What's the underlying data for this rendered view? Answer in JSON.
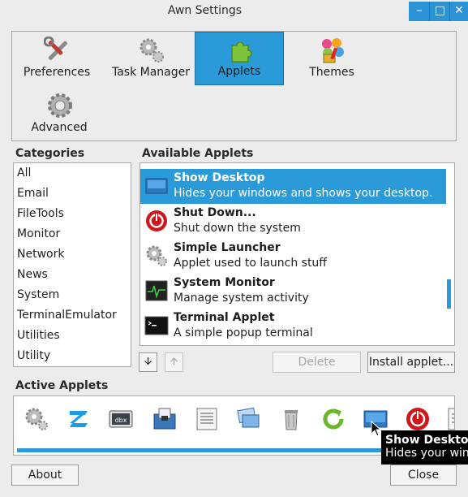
{
  "window": {
    "title": "Awn Settings",
    "minimize": "–",
    "maximize": "□",
    "close": "✕"
  },
  "categories_bar": [
    {
      "label": "Preferences",
      "icon": "tools-icon"
    },
    {
      "label": "Task Manager",
      "icon": "gears-icon"
    },
    {
      "label": "Applets",
      "icon": "puzzle-icon",
      "selected": true
    },
    {
      "label": "Themes",
      "icon": "paint-icon"
    },
    {
      "label": "Advanced",
      "icon": "gear-icon"
    }
  ],
  "categories_heading": "Categories",
  "categories": [
    "All",
    "Email",
    "FileTools",
    "Monitor",
    "Network",
    "News",
    "System",
    "TerminalEmulator",
    "Utilities",
    "Utility"
  ],
  "available_heading": "Available Applets",
  "applets": [
    {
      "name": "Show Desktop",
      "desc": "Hides your windows and shows your desktop.",
      "icon": "desktop-icon",
      "selected": true
    },
    {
      "name": "Shut Down...",
      "desc": "Shut down the system",
      "icon": "power-icon"
    },
    {
      "name": "Simple Launcher",
      "desc": "Applet used to launch stuff",
      "icon": "gears-icon"
    },
    {
      "name": "System Monitor",
      "desc": "Manage system activity",
      "icon": "monitor-icon"
    },
    {
      "name": "Terminal Applet",
      "desc": "A simple popup terminal",
      "icon": "terminal-icon"
    }
  ],
  "controls": {
    "move_down": "🡫",
    "move_up": "🡩",
    "delete": "Delete",
    "install": "Install applet..."
  },
  "active_heading": "Active Applets",
  "active_applets": [
    "gears-icon",
    "zorin-icon",
    "dbx-icon",
    "save-icon",
    "notes-icon",
    "windows-icon",
    "trash-icon",
    "refresh-icon",
    "desktop-icon",
    "power-icon",
    "list-icon"
  ],
  "tooltip": {
    "title": "Show Desktop",
    "text": "Hides your windows and shows your desktop."
  },
  "footer": {
    "about": "About",
    "close": "Close"
  },
  "colors": {
    "accent": "#2b9ad8",
    "window_bg": "#ececec"
  }
}
